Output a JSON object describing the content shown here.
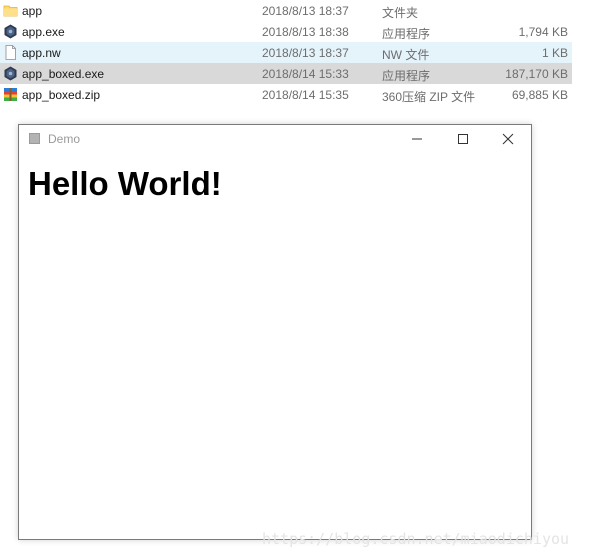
{
  "explorer": {
    "files": [
      {
        "name": "app",
        "date": "2018/8/13 18:37",
        "type": "文件夹",
        "size": "",
        "icon": "folder-icon"
      },
      {
        "name": "app.exe",
        "date": "2018/8/13 18:38",
        "type": "应用程序",
        "size": "1,794 KB",
        "icon": "nw-app-icon"
      },
      {
        "name": "app.nw",
        "date": "2018/8/13 18:37",
        "type": "NW 文件",
        "size": "1 KB",
        "icon": "blank-file-icon"
      },
      {
        "name": "app_boxed.exe",
        "date": "2018/8/14 15:33",
        "type": "应用程序",
        "size": "187,170 KB",
        "icon": "nw-app-icon"
      },
      {
        "name": "app_boxed.zip",
        "date": "2018/8/14 15:35",
        "type": "360压缩 ZIP 文件",
        "size": "69,885 KB",
        "icon": "zip-archive-icon"
      }
    ],
    "hover_row_color": "#e5f3fb",
    "selected_row_color": "#d9d9d9"
  },
  "demo_window": {
    "title": "Demo",
    "icon": "app-window-icon",
    "controls": [
      "minimize-icon",
      "maximize-icon",
      "close-icon"
    ],
    "heading": "Hello World!"
  },
  "watermark": "https://blog.csdn.net/miaodichiyou"
}
